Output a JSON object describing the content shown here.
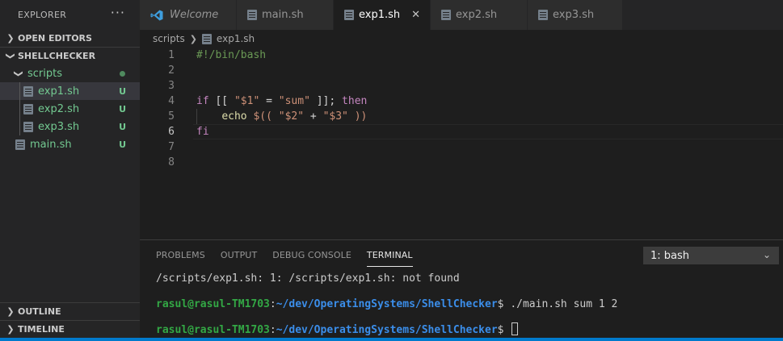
{
  "sidebar": {
    "title": "EXPLORER",
    "more": "···",
    "sections": {
      "open_editors": "OPEN EDITORS",
      "project": "SHELLCHECKER",
      "outline": "OUTLINE",
      "timeline": "TIMELINE"
    },
    "tree": {
      "folder": "scripts",
      "files": [
        {
          "name": "exp1.sh",
          "badge": "U"
        },
        {
          "name": "exp2.sh",
          "badge": "U"
        },
        {
          "name": "exp3.sh",
          "badge": "U"
        }
      ],
      "root_file": {
        "name": "main.sh",
        "badge": "U"
      }
    }
  },
  "tabs": [
    {
      "label": "Welcome",
      "icon": "vscode-icon"
    },
    {
      "label": "main.sh",
      "icon": "file-icon"
    },
    {
      "label": "exp1.sh",
      "icon": "file-icon",
      "active": true
    },
    {
      "label": "exp2.sh",
      "icon": "file-icon"
    },
    {
      "label": "exp3.sh",
      "icon": "file-icon"
    }
  ],
  "breadcrumb": {
    "folder": "scripts",
    "file": "exp1.sh"
  },
  "editor": {
    "line_numbers": [
      "1",
      "2",
      "3",
      "4",
      "5",
      "6",
      "7",
      "8"
    ],
    "line1": "#!/bin/bash",
    "line4": {
      "kw1": "if",
      "op1": " [[ ",
      "s1": "\"$1\"",
      "op2": " = ",
      "s2": "\"sum\"",
      "op3": " ]]; ",
      "kw2": "then"
    },
    "line5": {
      "indent": "    ",
      "fn": "echo",
      "op1": " ",
      "sub": "$((",
      "op2": " ",
      "s1": "\"$2\"",
      "op3": " + ",
      "s2": "\"$3\"",
      "op4": " ",
      "close": "))"
    },
    "line6": "fi"
  },
  "panel": {
    "tabs": [
      "PROBLEMS",
      "OUTPUT",
      "DEBUG CONSOLE",
      "TERMINAL"
    ],
    "terminal_select": "1: bash",
    "terminal": {
      "error_line": "/scripts/exp1.sh: 1: /scripts/exp1.sh: not found",
      "user": "rasul@rasul-TM1703",
      "colon": ":",
      "path": "~/dev/OperatingSystems/ShellChecker",
      "prompt": "$ ",
      "command": "./main.sh sum 1 2"
    }
  },
  "colors": {
    "accent": "#007acc",
    "untracked": "#73c991"
  }
}
